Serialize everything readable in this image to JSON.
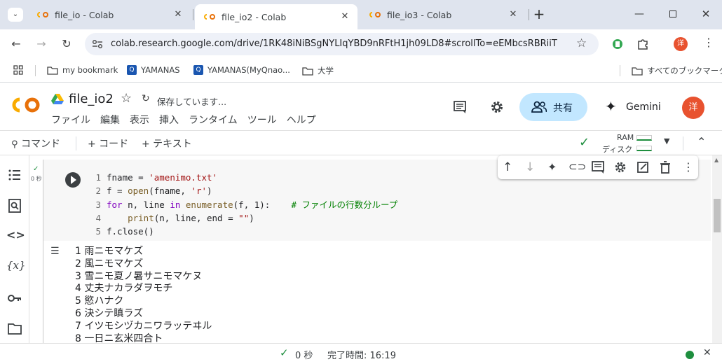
{
  "browser": {
    "tabs": [
      {
        "title": "file_io - Colab",
        "active": false
      },
      {
        "title": "file_io2 - Colab",
        "active": true
      },
      {
        "title": "file_io3 - Colab",
        "active": false
      }
    ],
    "url": "colab.research.google.com/drive/1RK48iNiBSgNYLIqYBD9nRFtH1jh09LD8#scrollTo=eEMbcsRBRiiT",
    "profile_initial": "洋",
    "bookmarks": [
      {
        "label": "my bookmark"
      },
      {
        "label": "YAMANAS"
      },
      {
        "label": "YAMANAS(MyQnao..."
      },
      {
        "label": "大学"
      }
    ],
    "all_bookmarks": "すべてのブックマーク"
  },
  "colab": {
    "notebook_title": "file_io2",
    "save_status": "保存しています...",
    "menu": [
      "ファイル",
      "編集",
      "表示",
      "挿入",
      "ランタイム",
      "ツール",
      "ヘルプ"
    ],
    "share_label": "共有",
    "gemini_label": "Gemini",
    "avatar_initial": "洋",
    "command_label": "コマンド",
    "add_code_label": "+ コード",
    "add_text_label": "+ テキスト",
    "ram_label": "RAM",
    "disk_label": "ディスク",
    "exec_time": "0 秒",
    "status_time": "0 秒",
    "status_completed": "完了時間: 16:19",
    "status_color": "#1e8e3e"
  },
  "cell": {
    "line_numbers": [
      "1",
      "2",
      "3",
      "4",
      "5"
    ],
    "output_lines": [
      "1 雨ニモマケズ",
      "2 風ニモマケズ",
      "3 雪ニモ夏ノ暑サニモマケヌ",
      "4 丈夫ナカラダヲモチ",
      "5 慾ハナク",
      "6 決シテ瞋ラズ",
      "7 イツモシヅカニワラッテヰル",
      "8 一日ニ玄米四合ト"
    ]
  }
}
